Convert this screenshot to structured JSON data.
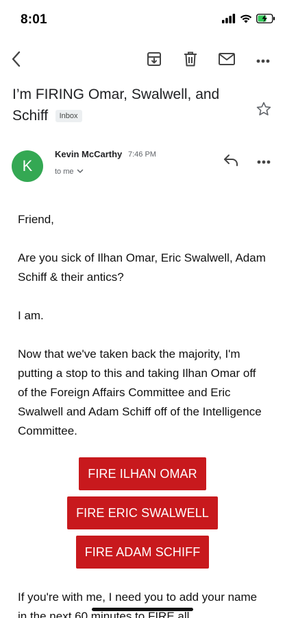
{
  "status_bar": {
    "time": "8:01"
  },
  "toolbar": {
    "back_icon": "chevron-left-icon",
    "archive_icon": "archive-icon",
    "delete_icon": "trash-icon",
    "mark_unread_icon": "mail-icon",
    "more_icon": "more-horizontal-icon"
  },
  "email": {
    "subject": "I’m FIRING Omar, Swalwell, and Schiff",
    "label": "Inbox",
    "sender": {
      "avatar_letter": "K",
      "avatar_color": "#34a853",
      "name": "Kevin McCarthy",
      "time": "7:46 PM",
      "to": "to me"
    },
    "body": {
      "greeting": "Friend,",
      "p1": "Are you sick of Ilhan Omar, Eric Swalwell, Adam Schiff & their antics?",
      "p2": "I am.",
      "p3": "Now that we've taken back the majority, I'm putting a stop to this and taking Ilhan Omar off of the Foreign Affairs Committee and Eric Swalwell and Adam Schiff off of the Intelligence Committee.",
      "buttons": [
        "FIRE ILHAN OMAR",
        "FIRE ERIC SWALWELL",
        "FIRE ADAM SCHIFF"
      ],
      "p4": "If you're with me, I need you to add your name in the next 60 minutes to FIRE all"
    },
    "button_color": "#c8191d"
  }
}
